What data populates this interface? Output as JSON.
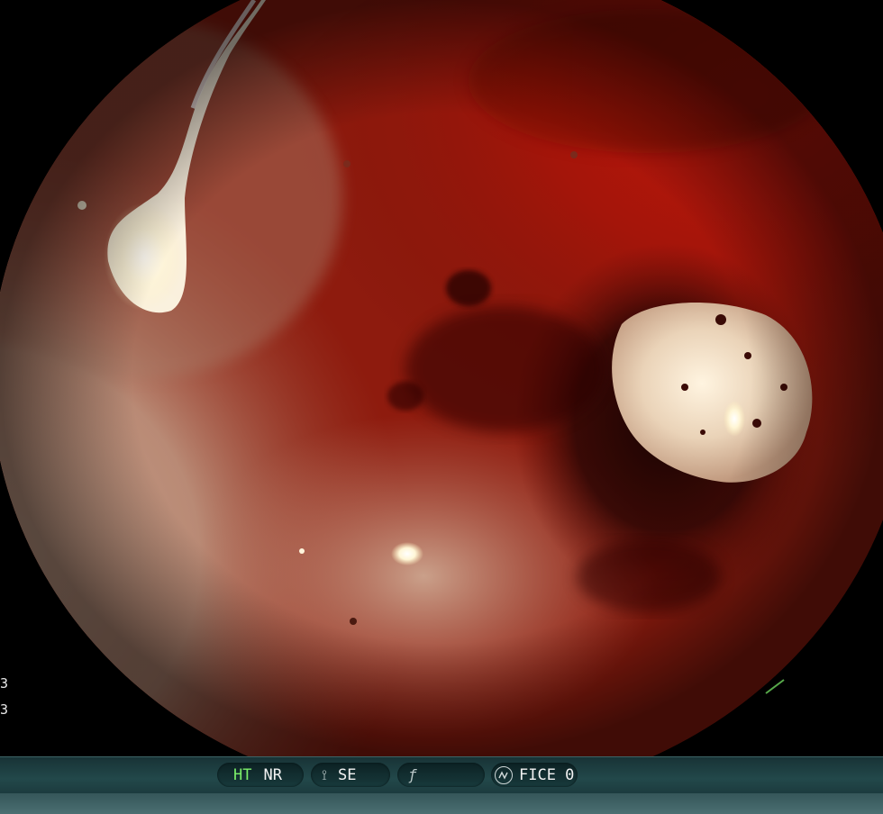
{
  "overlay": {
    "side_digits": [
      "3",
      "3"
    ]
  },
  "status_bar": {
    "ht_label": "HT",
    "nr_label": "NR",
    "se_icon": "structure-enhancement-icon",
    "se_label": "SE",
    "f_icon": "f-symbol-icon",
    "fice_icon": "waveform-circle-icon",
    "fice_label": "FICE 0"
  },
  "colors": {
    "mucosa_red": "#a81308",
    "mucosa_pale": "#c99880",
    "ht_green": "#7cf06a",
    "bar_teal": "#22484a"
  }
}
